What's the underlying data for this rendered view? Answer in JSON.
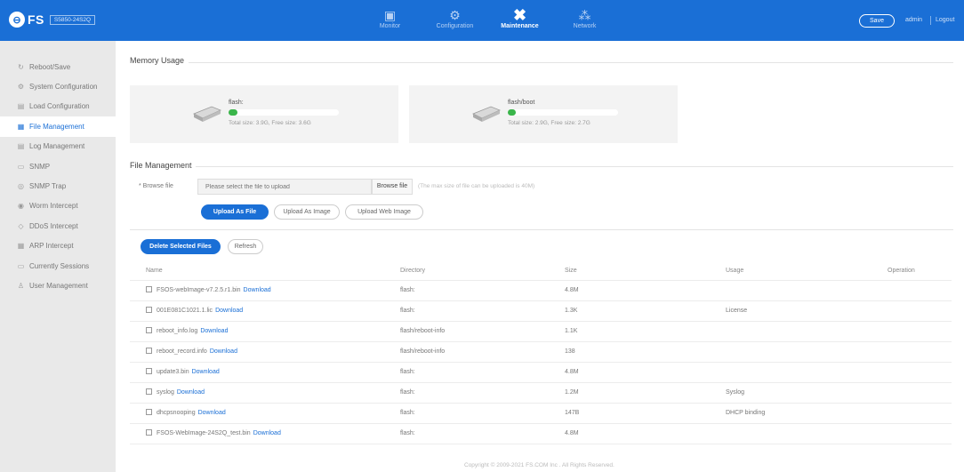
{
  "header": {
    "brand": "FS",
    "model": "S5850-24S2Q",
    "nav": [
      {
        "label": "Monitor",
        "icon": "monitor-icon",
        "active": false
      },
      {
        "label": "Configuration",
        "icon": "gear-icon",
        "active": false
      },
      {
        "label": "Maintenance",
        "icon": "tools-icon",
        "active": true
      },
      {
        "label": "Network",
        "icon": "network-icon",
        "active": false
      }
    ],
    "save_label": "Save",
    "user": "admin",
    "logout": "Logout"
  },
  "sidebar": {
    "items": [
      {
        "label": "Reboot/Save",
        "icon": "reboot-icon",
        "active": false
      },
      {
        "label": "System Configuration",
        "icon": "settings-icon",
        "active": false
      },
      {
        "label": "Load Configuration",
        "icon": "load-icon",
        "active": false
      },
      {
        "label": "File Management",
        "icon": "file-icon",
        "active": true
      },
      {
        "label": "Log Management",
        "icon": "log-icon",
        "active": false
      },
      {
        "label": "SNMP",
        "icon": "snmp-icon",
        "active": false
      },
      {
        "label": "SNMP Trap",
        "icon": "trap-icon",
        "active": false
      },
      {
        "label": "Worm Intercept",
        "icon": "worm-icon",
        "active": false
      },
      {
        "label": "DDoS Intercept",
        "icon": "shield-icon",
        "active": false
      },
      {
        "label": "ARP Intercept",
        "icon": "arp-icon",
        "active": false
      },
      {
        "label": "Currently Sessions",
        "icon": "sessions-icon",
        "active": false
      },
      {
        "label": "User Management",
        "icon": "user-icon",
        "active": false
      }
    ]
  },
  "memory": {
    "title": "Memory Usage",
    "cards": [
      {
        "name": "flash:",
        "meta": "Total size: 3.9G, Free size: 3.6G",
        "used_fraction": 0.08
      },
      {
        "name": "flash/boot",
        "meta": "Total size: 2.9G, Free size: 2.7G",
        "used_fraction": 0.07
      }
    ]
  },
  "files": {
    "title": "File Management",
    "browse_label": "* Browse file",
    "browse_placeholder": "Please select the file to upload",
    "browse_button": "Browse file",
    "browse_hint": "(The max size of file can be uploaded is 40M)",
    "upload_file": "Upload As File",
    "upload_image": "Upload As Image",
    "upload_web_image": "Upload Web Image",
    "delete_selected": "Delete Selected Files",
    "refresh": "Refresh",
    "columns": {
      "name": "Name",
      "directory": "Directory",
      "size": "Size",
      "usage": "Usage",
      "operation": "Operation"
    },
    "download_label": "Download",
    "rows": [
      {
        "name": "FSOS-webImage-v7.2.5.r1.bin",
        "directory": "flash:",
        "size": "4.8M",
        "usage": ""
      },
      {
        "name": "001E081C1021.1.lic",
        "directory": "flash:",
        "size": "1.3K",
        "usage": "License"
      },
      {
        "name": "reboot_info.log",
        "directory": "flash/reboot-info",
        "size": "1.1K",
        "usage": ""
      },
      {
        "name": "reboot_record.info",
        "directory": "flash/reboot-info",
        "size": "138",
        "usage": ""
      },
      {
        "name": "update3.bin",
        "directory": "flash:",
        "size": "4.8M",
        "usage": ""
      },
      {
        "name": "syslog",
        "directory": "flash:",
        "size": "1.2M",
        "usage": "Syslog"
      },
      {
        "name": "dhcpsnooping",
        "directory": "flash:",
        "size": "147B",
        "usage": "DHCP binding"
      },
      {
        "name": "FSOS-WebImage-24S2Q_test.bin",
        "directory": "flash:",
        "size": "4.8M",
        "usage": ""
      }
    ]
  },
  "footer": "Copyright © 2009-2021 FS.COM Inc . All Rights Reserved."
}
